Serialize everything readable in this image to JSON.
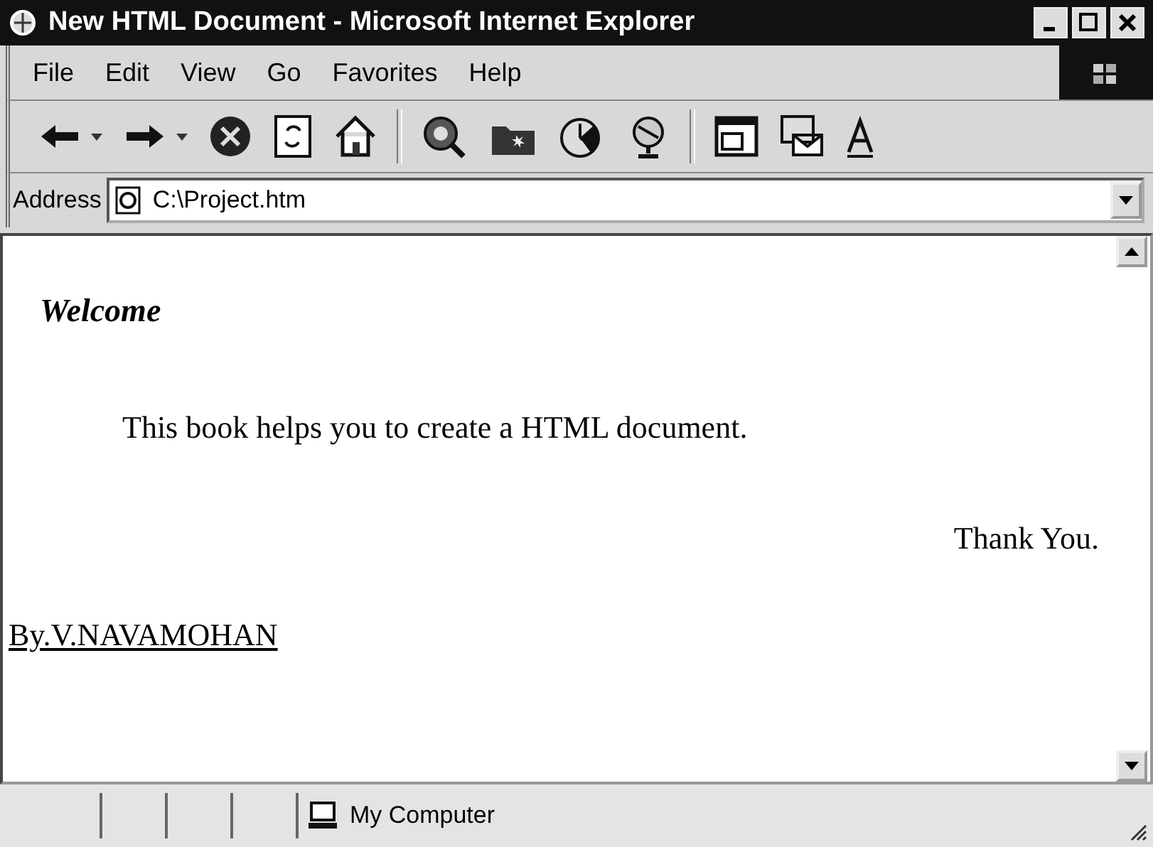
{
  "window": {
    "title": "New HTML Document - Microsoft Internet Explorer"
  },
  "menu": [
    {
      "label": "File"
    },
    {
      "label": "Edit"
    },
    {
      "label": "View"
    },
    {
      "label": "Go"
    },
    {
      "label": "Favorites"
    },
    {
      "label": "Help"
    }
  ],
  "address_bar": {
    "label": "Address",
    "value": "C:\\Project.htm"
  },
  "document": {
    "heading": "Welcome",
    "paragraph": "This book helps you to create a HTML document.",
    "closing": "Thank You.",
    "link": "By.V.NAVAMOHAN"
  },
  "status_bar": {
    "zone": "My Computer"
  }
}
